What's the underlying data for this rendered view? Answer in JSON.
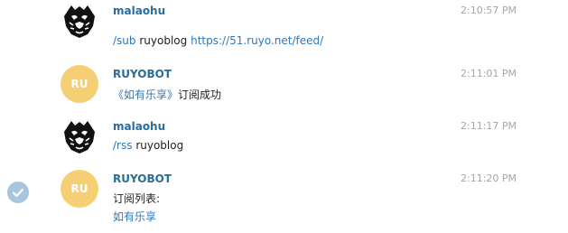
{
  "messages": [
    {
      "sender": "malaohu",
      "time": "2:10:57 PM",
      "lines": [
        {
          "cmd": "/sub",
          "arg1": "ruyoblog",
          "url": "https://51.ruyo.net/feed/"
        }
      ]
    },
    {
      "sender": "RUYOBOT",
      "avatar_text": "RU",
      "time": "2:11:01 PM",
      "lines": [
        {
          "quoted": "《如有乐享》",
          "rest": "订阅成功"
        }
      ]
    },
    {
      "sender": "malaohu",
      "time": "2:11:17 PM",
      "lines": [
        {
          "cmd": "/rss",
          "arg1": "ruyoblog"
        }
      ]
    },
    {
      "sender": "RUYOBOT",
      "avatar_text": "RU",
      "time": "2:11:20 PM",
      "lines": [
        {
          "text": "订阅列表:"
        },
        {
          "link": "如有乐享"
        }
      ]
    }
  ],
  "colors": {
    "sender": "#2a6d99",
    "link": "#2f78b9",
    "bot_avatar": "#f4cf73",
    "timestamp": "#a0a8ad",
    "selected_check": "#a7c6de"
  },
  "icons": {
    "user_avatar": "tiger-face-icon",
    "selection": "check-icon"
  }
}
